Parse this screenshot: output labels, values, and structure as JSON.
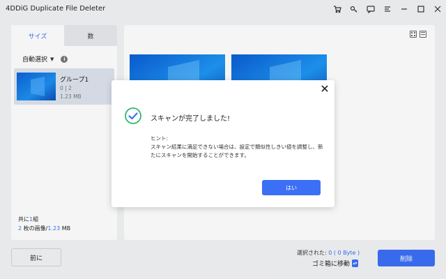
{
  "window": {
    "title": "4DDiG Duplicate File Deleter"
  },
  "titlebar_icons": [
    "cart-icon",
    "key-icon",
    "feedback-icon",
    "menu-icon",
    "minimize-icon",
    "maximize-icon",
    "close-icon"
  ],
  "left": {
    "tabs": [
      "サイズ",
      "数"
    ],
    "auto_select": "自動選択",
    "group": {
      "name": "グループ1",
      "count": "0 | 2",
      "size": "1.23 MB"
    },
    "summary": {
      "total_prefix": "共に",
      "total_value": "1",
      "total_suffix": "組",
      "images_count": "2",
      "images_label": " 枚の画像/",
      "images_size": "1.23",
      "images_unit": " MB"
    }
  },
  "dialog": {
    "title": "スキャンが完了しました!",
    "hint_label": "ヒント:",
    "hint_text": "スキャン結果に満足できない場合は、設定で類似性しきい値を調整し、新たにスキャンを開始することができます。",
    "ok": "はい"
  },
  "bottom": {
    "back": "前に",
    "selected_label": "選択された:",
    "selected_value": "0",
    "selected_bytes": "( 0 Byte )",
    "move_to_trash": "ゴミ箱に移動",
    "delete": "削除"
  },
  "colors": {
    "accent": "#3b6ff5",
    "success": "#2bb673"
  }
}
